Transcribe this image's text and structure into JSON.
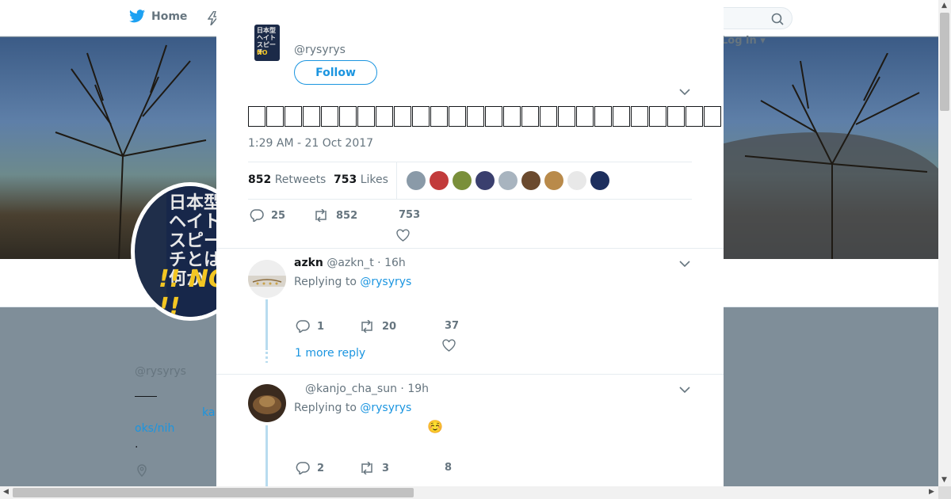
{
  "nav": {
    "home_label": "Home",
    "login_label": "Log in"
  },
  "profile": {
    "name": "",
    "handle": "@rysyrys",
    "link_fragment_1": "ka",
    "link_fragment_2": "oks/nih",
    "dot": "."
  },
  "tweet": {
    "handle": "@rysyrys",
    "follow_label": "Follow",
    "text": "",
    "timestamp": "1:29 AM - 21 Oct 2017",
    "retweets_count": "852",
    "retweets_label": "Retweets",
    "likes_count": "753",
    "likes_label": "Likes",
    "liker_colors": [
      "#8a9aa8",
      "#c23b3b",
      "#7a8f3a",
      "#3a3f6e",
      "#a8b4bf",
      "#6b4a2e",
      "#b98a4a",
      "#e8e8e8",
      "#1d2f5e"
    ],
    "replies": "25",
    "retweets": "852",
    "likes": "753"
  },
  "replies": [
    {
      "name": "azkn",
      "handle": "@azkn_t",
      "time": "16h",
      "replying_label": "Replying to",
      "replying_to": "@rysyrys",
      "text": "",
      "replies": "1",
      "retweets": "20",
      "likes": "37",
      "more_label": "1 more reply"
    },
    {
      "name": "",
      "handle": "@kanjo_cha_sun",
      "time": "19h",
      "replying_label": "Replying to",
      "replying_to": "@rysyrys",
      "text": "☺️",
      "replies": "2",
      "retweets": "3",
      "likes": "8"
    }
  ],
  "colors": {
    "accent": "#1b95e0",
    "twitter_blue": "#1da1f2",
    "muted": "#66757f"
  },
  "icons": [
    "twitter-bird-icon",
    "lightning-icon",
    "search-icon",
    "close-icon",
    "chevron-down-icon",
    "reply-icon",
    "retweet-icon",
    "heart-icon",
    "location-pin-icon"
  ]
}
